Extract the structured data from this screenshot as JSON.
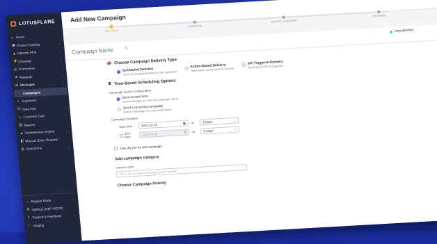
{
  "brand": {
    "name": "LOTUSFLARE"
  },
  "sidebar": {
    "items": [
      {
        "icon": "⌂",
        "label": "Home",
        "chevron": ""
      },
      {
        "icon": "▣",
        "label": "Product Catalog",
        "chevron": "⌄"
      },
      {
        "icon": "▲",
        "label": "Operate APIs",
        "chevron": "⌄"
      },
      {
        "icon": "⚡",
        "label": "Charging",
        "chevron": "⌄"
      },
      {
        "icon": "◎",
        "label": "Promotions",
        "chevron": ""
      },
      {
        "icon": "★",
        "label": "Rewards",
        "chevron": "⌄"
      },
      {
        "icon": "✉",
        "label": "Messages",
        "chevron": "⌃"
      },
      {
        "icon": "",
        "label": "Campaigns",
        "chevron": ""
      },
      {
        "icon": "◑",
        "label": "Segments",
        "chevron": ""
      },
      {
        "icon": "⛁",
        "label": "Data Hub",
        "chevron": "⌄"
      },
      {
        "icon": "☺",
        "label": "Customer Care",
        "chevron": "⌄"
      },
      {
        "icon": "▤",
        "label": "Reports",
        "chevron": ""
      },
      {
        "icon": "▲",
        "label": "Orchestration Engine",
        "chevron": "⌄"
      },
      {
        "icon": "◧",
        "label": "Manual Order Resume",
        "chevron": ""
      },
      {
        "icon": "◍",
        "label": "Operations",
        "chevron": "⌄"
      }
    ],
    "bottom": [
      {
        "icon": "◔",
        "label": "Regular Mode",
        "chevron": "⌄"
      },
      {
        "icon": "⚙",
        "label": "Settings (GMT+02:00)",
        "chevron": ""
      },
      {
        "icon": "?",
        "label": "Support & Feedback",
        "chevron": "⌄"
      },
      {
        "icon": "‹",
        "label": "Staging",
        "chevron": ""
      }
    ]
  },
  "header": {
    "title": "Add New Campaign"
  },
  "stepper": {
    "steps": [
      "DELIVERY",
      "COMPOSE",
      "TARGET AUDIENCE",
      "CONFIRM"
    ]
  },
  "campaign": {
    "name": "Campaign Name",
    "status": "Unpublished"
  },
  "delivery": {
    "title": "Choose Campaign Delivery Type",
    "options": [
      {
        "title": "Scheduled Delivery",
        "desc": "Send at designated times of the day/week"
      },
      {
        "title": "Action-Based Delivery",
        "desc": "Send when users perform actions"
      },
      {
        "title": "API Triggered Delivery",
        "desc": "Send when API is triggered"
      }
    ]
  },
  "scheduling": {
    "title": "Time-Based Scheduling Options",
    "launch_label": "Campaign launch configuration:",
    "launch_options": [
      {
        "title": "Send at start time",
        "desc": "Send message as soon as campaign starts"
      },
      {
        "title": "Send a recurring campaign",
        "desc": "Deliver message on a recurring basis"
      }
    ],
    "duration_label": "Campaign Duration",
    "start": {
      "label": "Start time",
      "date": "2024-10-14",
      "at": "at",
      "time": "3:13pm"
    },
    "end": {
      "label": "End time",
      "date": "2024-10-15",
      "at": "at",
      "time": "3:13pm"
    }
  },
  "dry_run": {
    "label": "Use dry run for this campaign"
  },
  "category": {
    "title": "Add campaign category",
    "field_label": "Category name",
    "placeholder": "There are no options selected at the moment"
  },
  "next_section": {
    "title": "Choose Campaign Priority"
  }
}
